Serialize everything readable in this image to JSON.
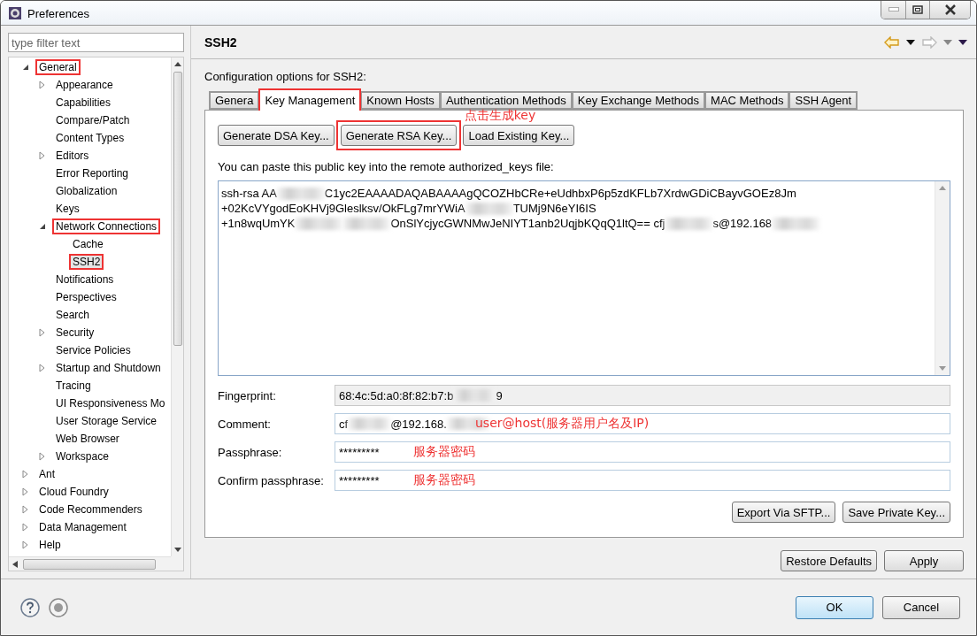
{
  "window": {
    "title": "Preferences"
  },
  "filter": {
    "placeholder": "type filter text"
  },
  "tree": [
    {
      "label": "General",
      "expanded": true,
      "selected": false,
      "highlighted": true,
      "children": [
        {
          "label": "Appearance",
          "expanded": false,
          "selected": false,
          "highlighted": false
        },
        {
          "label": "Capabilities",
          "selected": false,
          "highlighted": false
        },
        {
          "label": "Compare/Patch",
          "selected": false,
          "highlighted": false
        },
        {
          "label": "Content Types",
          "selected": false,
          "highlighted": false
        },
        {
          "label": "Editors",
          "expanded": false,
          "selected": false,
          "highlighted": false
        },
        {
          "label": "Error Reporting",
          "selected": false,
          "highlighted": false
        },
        {
          "label": "Globalization",
          "selected": false,
          "highlighted": false
        },
        {
          "label": "Keys",
          "selected": false,
          "highlighted": false
        },
        {
          "label": "Network Connections",
          "expanded": true,
          "selected": false,
          "highlighted": true,
          "children": [
            {
              "label": "Cache",
              "selected": false,
              "highlighted": false
            },
            {
              "label": "SSH2",
              "selected": true,
              "highlighted": true
            }
          ]
        },
        {
          "label": "Notifications",
          "selected": false,
          "highlighted": false
        },
        {
          "label": "Perspectives",
          "selected": false,
          "highlighted": false
        },
        {
          "label": "Search",
          "selected": false,
          "highlighted": false
        },
        {
          "label": "Security",
          "expanded": false,
          "selected": false,
          "highlighted": false
        },
        {
          "label": "Service Policies",
          "selected": false,
          "highlighted": false
        },
        {
          "label": "Startup and Shutdown",
          "expanded": false,
          "selected": false,
          "highlighted": false
        },
        {
          "label": "Tracing",
          "selected": false,
          "highlighted": false
        },
        {
          "label": "UI Responsiveness Mo",
          "selected": false,
          "highlighted": false
        },
        {
          "label": "User Storage Service",
          "selected": false,
          "highlighted": false
        },
        {
          "label": "Web Browser",
          "selected": false,
          "highlighted": false
        },
        {
          "label": "Workspace",
          "expanded": false,
          "selected": false,
          "highlighted": false
        }
      ]
    },
    {
      "label": "Ant",
      "expanded": false,
      "selected": false,
      "highlighted": false
    },
    {
      "label": "Cloud Foundry",
      "expanded": false,
      "selected": false,
      "highlighted": false
    },
    {
      "label": "Code Recommenders",
      "expanded": false,
      "selected": false,
      "highlighted": false
    },
    {
      "label": "Data Management",
      "expanded": false,
      "selected": false,
      "highlighted": false
    },
    {
      "label": "Help",
      "expanded": false,
      "selected": false,
      "highlighted": false
    }
  ],
  "page": {
    "title": "SSH2",
    "description": "Configuration options for SSH2:"
  },
  "tabs": [
    {
      "label": "Genera",
      "selected": false,
      "highlighted": false
    },
    {
      "label": "Key Management",
      "selected": true,
      "highlighted": true
    },
    {
      "label": "Known Hosts",
      "selected": false,
      "highlighted": false
    },
    {
      "label": "Authentication Methods",
      "selected": false,
      "highlighted": false
    },
    {
      "label": "Key Exchange Methods",
      "selected": false,
      "highlighted": false
    },
    {
      "label": "MAC Methods",
      "selected": false,
      "highlighted": false
    },
    {
      "label": "SSH Agent",
      "selected": false,
      "highlighted": false
    }
  ],
  "key_buttons": [
    {
      "label": "Generate DSA Key..."
    },
    {
      "label": "Generate RSA Key...",
      "highlighted": true,
      "annotation": "点击生成key"
    },
    {
      "label": "Load Existing Key..."
    }
  ],
  "paste_hint": "You can paste this public key into the remote authorized_keys file:",
  "public_key": [
    [
      {
        "kind": "text",
        "text": "ssh-rsa AA"
      },
      {
        "kind": "redacted"
      },
      {
        "kind": "text",
        "text": "C1yc2EAAAADAQABAAAAgQCOZHbCRe+eUdhbxP6p5zdKFLb7XrdwGDiCBayvGOEz8Jm"
      }
    ],
    [
      {
        "kind": "text",
        "text": "+02KcVYgodEoKHVj9Gleslksv/OkFLg7mrYWiA"
      },
      {
        "kind": "redacted"
      },
      {
        "kind": "text",
        "text": "TUMj9N6eYI6IS"
      }
    ],
    [
      {
        "kind": "text",
        "text": "+1n8wqUmYK"
      },
      {
        "kind": "redacted"
      },
      {
        "kind": "redacted"
      },
      {
        "kind": "text",
        "text": "OnSlYcjycGWNMwJeNIYT1anb2UqjbKQqQ1ltQ== cfj"
      },
      {
        "kind": "redacted"
      },
      {
        "kind": "text",
        "text": "s@192.168"
      },
      {
        "kind": "redacted"
      }
    ]
  ],
  "fields": [
    {
      "label": "Fingerprint:",
      "readonly": true,
      "value": [
        {
          "kind": "text",
          "text": "68:4c:5d:a0:8f:82:b7:b"
        },
        {
          "kind": "redacted"
        },
        {
          "kind": "text",
          "text": "9"
        }
      ]
    },
    {
      "label": "Comment:",
      "readonly": false,
      "value": [
        {
          "kind": "text",
          "text": "cf"
        },
        {
          "kind": "redacted"
        },
        {
          "kind": "text",
          "text": "@192.168."
        },
        {
          "kind": "redacted"
        }
      ],
      "annotation": "user@host(服务器用户名及IP)"
    },
    {
      "label": "Passphrase:",
      "readonly": false,
      "value": [
        {
          "kind": "text",
          "text": "*********"
        }
      ],
      "annotation": "服务器密码"
    },
    {
      "label": "Confirm passphrase:",
      "readonly": false,
      "value": [
        {
          "kind": "text",
          "text": "*********"
        }
      ],
      "annotation": "服务器密码"
    }
  ],
  "export_buttons": [
    "Export Via SFTP...",
    "Save Private Key..."
  ],
  "page_buttons": [
    "Restore Defaults",
    "Apply"
  ],
  "dialog_buttons": [
    {
      "label": "OK",
      "default": true
    },
    {
      "label": "Cancel",
      "default": false
    }
  ]
}
